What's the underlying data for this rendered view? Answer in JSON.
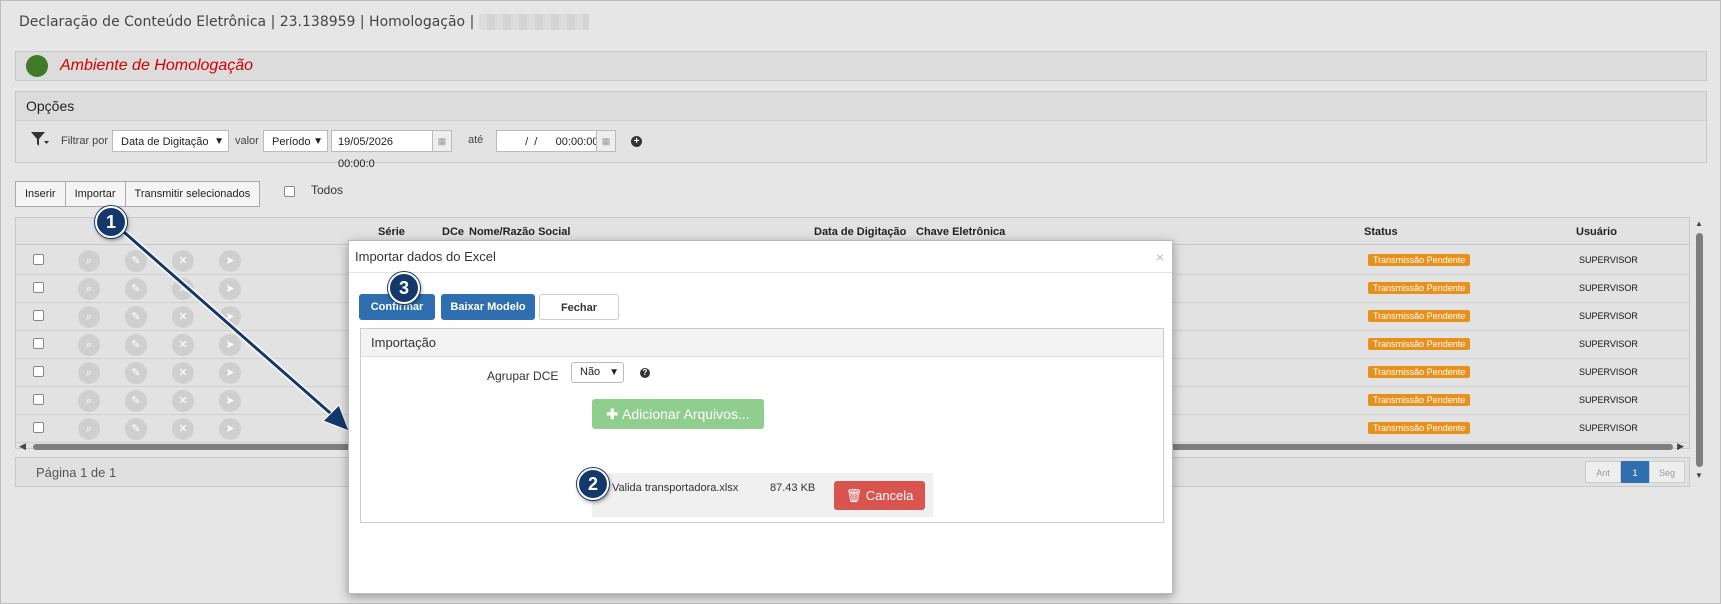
{
  "window": {
    "title": "Declaração de Conteúdo Eletrônica | 23.138959 | Homologação |"
  },
  "environment": {
    "label": "Ambiente de Homologação",
    "status_color": "#3e7a28"
  },
  "options": {
    "header": "Opções",
    "filter_label": "Filtrar por",
    "filter_field": "Data de Digitação",
    "value_label": "valor",
    "value_mode": "Período",
    "date_from": "19/05/2026 00:00:0",
    "until_label": "até",
    "date_to": "  /  /      00:00:00"
  },
  "toolbar": {
    "insert": "Inserir",
    "import": "Importar",
    "transmit": "Transmitir selecionados",
    "all": "Todos"
  },
  "grid": {
    "columns": {
      "serie": "Série",
      "dce": "DCe",
      "name": "Nome/Razão Social",
      "date": "Data de Digitação",
      "key": "Chave Eletrônica",
      "status": "Status",
      "user": "Usuário"
    },
    "rows": [
      {
        "status": "Transmissão Pendente",
        "user": "SUPERVISOR"
      },
      {
        "status": "Transmissão Pendente",
        "user": "SUPERVISOR"
      },
      {
        "status": "Transmissão Pendente",
        "user": "SUPERVISOR"
      },
      {
        "status": "Transmissão Pendente",
        "user": "SUPERVISOR"
      },
      {
        "status": "Transmissão Pendente",
        "user": "SUPERVISOR"
      },
      {
        "status": "Transmissão Pendente",
        "user": "SUPERVISOR"
      },
      {
        "status": "Transmissão Pendente",
        "user": "SUPERVISOR"
      }
    ],
    "status_color": "#e8901c"
  },
  "pager": {
    "info": "Página 1 de 1",
    "prev": "Ant",
    "current": "1",
    "next": "Seg"
  },
  "modal": {
    "title": "Importar dados do Excel",
    "confirm": "Confirmar",
    "download_template": "Baixar Modelo",
    "close": "Fechar",
    "section": "Importação",
    "group_label": "Agrupar DCE",
    "group_value": "Não",
    "add_files": "Adicionar Arquivos...",
    "file_name": "Valida transportadora.xlsx",
    "file_size": "87.43 KB",
    "cancel": "Cancela"
  },
  "callouts": [
    "1",
    "2",
    "3"
  ]
}
